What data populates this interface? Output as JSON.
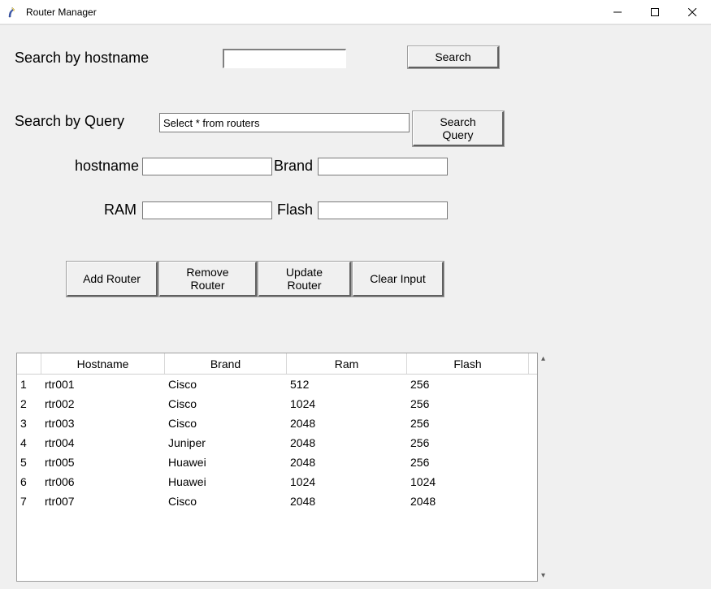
{
  "window": {
    "title": "Router Manager"
  },
  "search_hostname": {
    "label": "Search by hostname",
    "value": "",
    "button": "Search"
  },
  "search_query": {
    "label": "Search by Query",
    "value": "Select * from routers",
    "button": "Search Query"
  },
  "fields": {
    "hostname": {
      "label": "hostname",
      "value": ""
    },
    "brand": {
      "label": "Brand",
      "value": ""
    },
    "ram": {
      "label": "RAM",
      "value": ""
    },
    "flash": {
      "label": "Flash",
      "value": ""
    }
  },
  "actions": {
    "add": "Add Router",
    "remove": "Remove Router",
    "update": "Update Router",
    "clear": "Clear Input"
  },
  "table": {
    "headers": [
      "Hostname",
      "Brand",
      "Ram",
      "Flash"
    ],
    "rows": [
      {
        "id": "1",
        "hostname": "rtr001",
        "brand": "Cisco",
        "ram": "512",
        "flash": "256"
      },
      {
        "id": "2",
        "hostname": "rtr002",
        "brand": "Cisco",
        "ram": "1024",
        "flash": "256"
      },
      {
        "id": "3",
        "hostname": "rtr003",
        "brand": "Cisco",
        "ram": "2048",
        "flash": "256"
      },
      {
        "id": "4",
        "hostname": "rtr004",
        "brand": "Juniper",
        "ram": "2048",
        "flash": "256"
      },
      {
        "id": "5",
        "hostname": "rtr005",
        "brand": "Huawei",
        "ram": "2048",
        "flash": "256"
      },
      {
        "id": "6",
        "hostname": "rtr006",
        "brand": "Huawei",
        "ram": "1024",
        "flash": "1024"
      },
      {
        "id": "7",
        "hostname": "rtr007",
        "brand": "Cisco",
        "ram": "2048",
        "flash": "2048"
      }
    ]
  }
}
